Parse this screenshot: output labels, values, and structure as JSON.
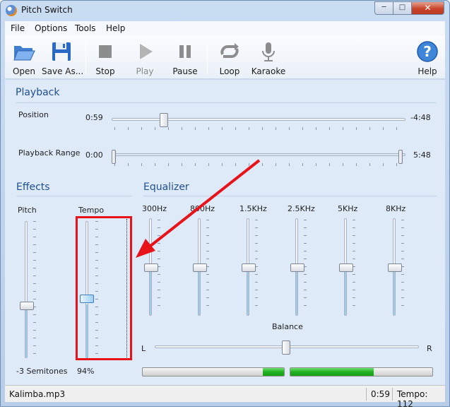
{
  "window": {
    "title": "Pitch Switch"
  },
  "window_controls": {
    "minimize": "─",
    "maximize": "□",
    "close": "✕"
  },
  "menu": [
    "File",
    "Options",
    "Tools",
    "Help"
  ],
  "toolbar": {
    "open": "Open",
    "save": "Save As...",
    "stop": "Stop",
    "play": "Play",
    "pause": "Pause",
    "loop": "Loop",
    "karaoke": "Karaoke",
    "help": "Help"
  },
  "icons": {
    "open": "folder-open-icon",
    "save": "floppy-disk-icon",
    "stop": "stop-icon",
    "play": "play-icon",
    "pause": "pause-icon",
    "loop": "loop-icon",
    "karaoke": "microphone-icon",
    "help": "help-question-icon"
  },
  "playback": {
    "title": "Playback",
    "position_label": "Position",
    "position_time": "0:59",
    "position_remaining": "-4:48",
    "range_label": "Playback Range",
    "range_start": "0:00",
    "range_end": "5:48"
  },
  "effects": {
    "title": "Effects",
    "pitch_label": "Pitch",
    "pitch_value": "-3 Semitones",
    "tempo_label": "Tempo",
    "tempo_value": "94%"
  },
  "equalizer": {
    "title": "Equalizer",
    "bands": [
      "300Hz",
      "800Hz",
      "1.5KHz",
      "2.5KHz",
      "5KHz",
      "8KHz"
    ],
    "balance_label": "Balance",
    "balance_left": "L",
    "balance_right": "R"
  },
  "status": {
    "file": "Kalimba.mp3",
    "time": "0:59",
    "tempo": "Tempo: 112"
  },
  "colors": {
    "accent_title": "#1f4f8f",
    "annotation": "#e8131a",
    "meter_green": "#22b022"
  }
}
